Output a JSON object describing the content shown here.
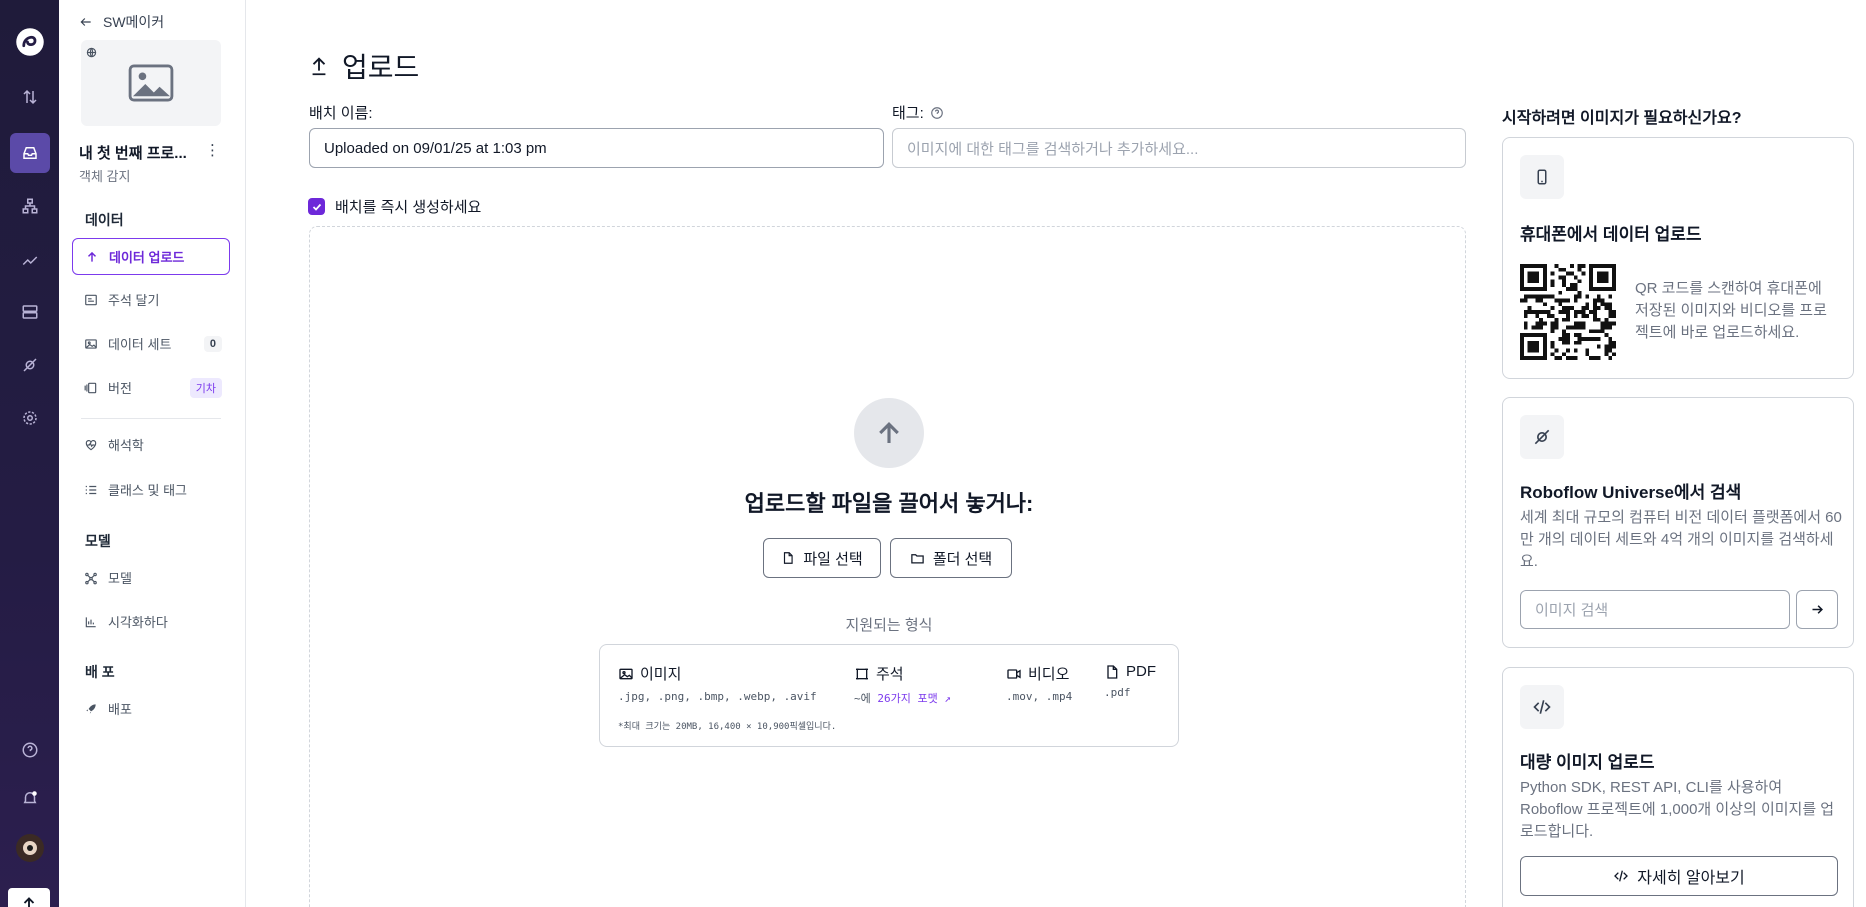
{
  "sidebar": {
    "back_label": "SW메이커",
    "project_name": "내 첫 번째 프로...",
    "project_type": "객체 감지",
    "sections": {
      "data": "데이터",
      "models": "모델",
      "deploy": "배 포"
    },
    "items": [
      {
        "label": "데이터 업로드",
        "icon": "upload-icon"
      },
      {
        "label": "주석 달기",
        "icon": "annotate-icon"
      },
      {
        "label": "데이터 세트",
        "icon": "dataset-icon",
        "badge": "0"
      },
      {
        "label": "버전",
        "icon": "versions-icon",
        "badge": "기차"
      },
      {
        "label": "해석학",
        "icon": "analytics-icon"
      },
      {
        "label": "클래스 및 태그",
        "icon": "list-icon"
      },
      {
        "label": "모델",
        "icon": "model-icon"
      },
      {
        "label": "시각화하다",
        "icon": "chart-icon"
      },
      {
        "label": "배포",
        "icon": "rocket-icon"
      }
    ]
  },
  "main": {
    "title": "업로드",
    "batch_label": "배치 이름:",
    "batch_value": "Uploaded on 09/01/25 at 1:03 pm",
    "tags_label": "태그:",
    "tags_placeholder": "이미지에 대한 태그를 검색하거나 추가하세요...",
    "checkbox_label": "배치를 즉시 생성하세요",
    "drop_heading": "업로드할 파일을 끌어서 놓거나:",
    "select_files": "파일 선택",
    "select_folder": "폴더 선택",
    "formats_title": "지원되는 형식",
    "formats": {
      "images": {
        "label": "이미지",
        "ext": ".jpg, .png, .bmp, .webp, .avif"
      },
      "annotations": {
        "label": "주석",
        "prefix": "~에",
        "link": "26가지 포맷"
      },
      "video": {
        "label": "비디오",
        "ext": ".mov, .mp4"
      },
      "pdf": {
        "label": "PDF",
        "ext": ".pdf"
      }
    },
    "formats_note": "*최대 크기는 20MB, 16,400 × 10,900픽셀입니다."
  },
  "right": {
    "title": "시작하려면 이미지가 필요하신가요?",
    "phone_card": {
      "title": "휴대폰에서 데이터 업로드",
      "desc": "QR 코드를 스캔하여 휴대폰에 저장된 이미지와 비디오를 프로젝트에 바로 업로드하세요."
    },
    "universe_card": {
      "title": "Roboflow Universe에서 검색",
      "desc": "세계 최대 규모의 컴퓨터 비전 데이터 플랫폼에서 60만 개의 데이터 세트와 4억 개의 이미지를 검색하세요.",
      "search_placeholder": "이미지 검색"
    },
    "bulk_card": {
      "title": "대량 이미지 업로드",
      "desc": "Python SDK, REST API, CLI를 사용하여 Roboflow 프로젝트에 1,000개 이상의 이미지를 업로드합니다.",
      "button": "자세히 알아보기"
    }
  },
  "colors": {
    "accent": "#7c3aed",
    "rail": "#241c44"
  }
}
